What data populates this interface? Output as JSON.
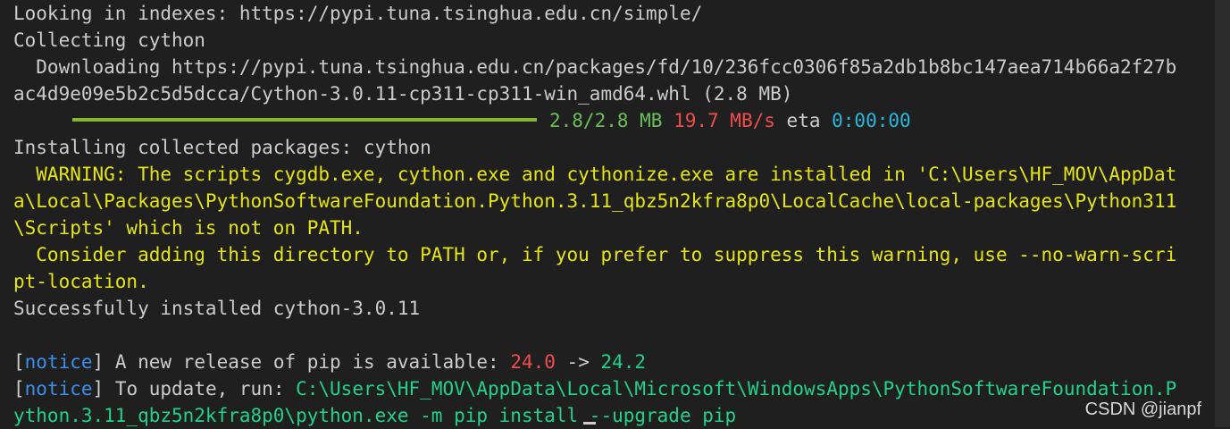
{
  "terminal": {
    "line1": "Looking in indexes: https://pypi.tuna.tsinghua.edu.cn/simple/",
    "line2": "Collecting cython",
    "line3": "  Downloading https://pypi.tuna.tsinghua.edu.cn/packages/fd/10/236fcc0306f85a2db1b8bc147aea714b66a2f27b",
    "line4": "ac4d9e09e5b2c5d5dcca/Cython-3.0.11-cp311-cp311-win_amd64.whl (2.8 MB)",
    "progress": {
      "size": "2.8/2.8 MB",
      "speed": "19.7 MB/s",
      "eta_label": "eta",
      "eta_value": "0:00:00",
      "fraction": 1.0
    },
    "line6": "Installing collected packages: cython",
    "warn1": "  WARNING: The scripts cygdb.exe, cython.exe and cythonize.exe are installed in 'C:\\Users\\HF_MOV\\AppDat",
    "warn2": "a\\Local\\Packages\\PythonSoftwareFoundation.Python.3.11_qbz5n2kfra8p0\\LocalCache\\local-packages\\Python311",
    "warn3": "\\Scripts' which is not on PATH.",
    "warn4": "  Consider adding this directory to PATH or, if you prefer to suppress this warning, use --no-warn-scri",
    "warn5": "pt-location.",
    "line12": "Successfully installed cython-3.0.11",
    "notice1": {
      "open": "[",
      "tag": "notice",
      "close": "]",
      "text": " A new release of pip is available: ",
      "old": "24.0",
      "arrow": " -> ",
      "new": "24.2"
    },
    "notice2": {
      "open": "[",
      "tag": "notice",
      "close": "]",
      "text": " To update, run: ",
      "cmd1": "C:\\Users\\HF_MOV\\AppData\\Local\\Microsoft\\WindowsApps\\PythonSoftwareFoundation.P",
      "cmd2": "ython.3.11_qbz5n2kfra8p0\\python.exe -m pip install --upgrade pip"
    }
  },
  "watermark": "CSDN @jianpf"
}
